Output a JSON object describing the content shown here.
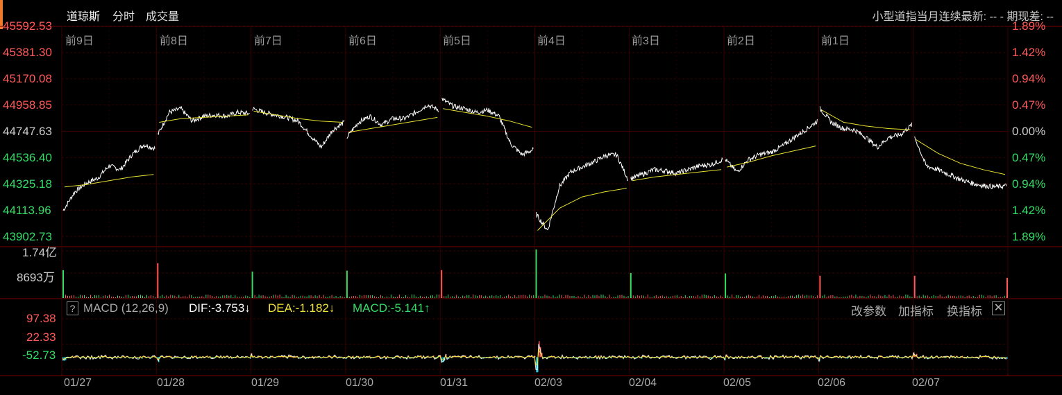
{
  "header": {
    "title": "道琼斯",
    "tab_minute": "分时",
    "tab_volume": "成交量",
    "info": "小型道指当月连续最新: --  -    期现差: --"
  },
  "price_axis": {
    "left_labels": [
      "45592.53",
      "45381.30",
      "45170.08",
      "44958.85",
      "44747.63",
      "44536.40",
      "44325.18",
      "44113.96",
      "43902.73"
    ],
    "right_labels": [
      "1.89%",
      "1.42%",
      "0.94%",
      "0.47%",
      "0.00%",
      "0.47%",
      "0.94%",
      "1.42%",
      "1.89%"
    ]
  },
  "day_labels": [
    "前9日",
    "前8日",
    "前7日",
    "前6日",
    "前5日",
    "前4日",
    "前3日",
    "前2日",
    "前1日"
  ],
  "volume_axis": {
    "top": "1.74亿",
    "mid": "8693万"
  },
  "macd": {
    "label": "MACD (12,26,9)",
    "dif": "DIF:-3.753↓",
    "dea": "DEA:-1.182↓",
    "macd": "MACD:-5.141↑",
    "btn_params": "改参数",
    "btn_add": "加指标",
    "btn_switch": "换指标",
    "help": "?",
    "close": "✕",
    "axis": [
      "97.38",
      "22.33",
      "-52.73"
    ]
  },
  "date_labels": [
    "01/27",
    "01/28",
    "01/29",
    "01/30",
    "01/31",
    "02/03",
    "02/04",
    "02/05",
    "02/06",
    "02/07"
  ],
  "colors": {
    "up": "#ff5a5a",
    "down": "#33dd66",
    "price_line": "#ffffff",
    "avg_line": "#e8e030",
    "cyan": "#22d0e8",
    "grid": "#3a0000"
  },
  "chart_data": [
    {
      "type": "line",
      "title": "道琼斯",
      "ylim": [
        43902.73,
        45592.53
      ],
      "base": 44747.63,
      "days": [
        "01/27",
        "01/28",
        "01/29",
        "01/30",
        "01/31",
        "02/03",
        "02/04",
        "02/05",
        "02/06",
        "02/07"
      ],
      "series": [
        {
          "name": "price",
          "day_points": [
            [
              44110,
              44260,
              44330,
              44370,
              44470,
              44440,
              44560,
              44640,
              44610
            ],
            [
              44720,
              44900,
              44930,
              44830,
              44870,
              44880,
              44870,
              44900,
              44890
            ],
            [
              44930,
              44900,
              44880,
              44860,
              44830,
              44720,
              44620,
              44760,
              44820
            ],
            [
              44700,
              44820,
              44870,
              44800,
              44850,
              44850,
              44900,
              44960,
              44920
            ],
            [
              45010,
              44950,
              44930,
              44900,
              44920,
              44870,
              44650,
              44560,
              44600
            ],
            [
              44080,
              43950,
              44300,
              44420,
              44460,
              44500,
              44550,
              44560,
              44360
            ],
            [
              44370,
              44400,
              44440,
              44430,
              44410,
              44440,
              44470,
              44480,
              44520
            ],
            [
              44520,
              44420,
              44520,
              44560,
              44580,
              44630,
              44700,
              44760,
              44830
            ],
            [
              44930,
              44820,
              44770,
              44760,
              44700,
              44620,
              44700,
              44720,
              44800
            ],
            [
              44700,
              44470,
              44440,
              44400,
              44360,
              44330,
              44310,
              44300,
              44310
            ]
          ]
        },
        {
          "name": "avg",
          "day_points": [
            [
              44300,
              44320,
              44350,
              44380,
              44400
            ],
            [
              44820,
              44850,
              44860,
              44870,
              44880
            ],
            [
              44910,
              44880,
              44850,
              44830,
              44820
            ],
            [
              44740,
              44770,
              44800,
              44830,
              44860
            ],
            [
              44930,
              44900,
              44870,
              44830,
              44780
            ],
            [
              43950,
              44130,
              44220,
              44260,
              44290
            ],
            [
              44350,
              44380,
              44400,
              44420,
              44440
            ],
            [
              44460,
              44500,
              44550,
              44590,
              44630
            ],
            [
              44920,
              44820,
              44790,
              44770,
              44760
            ],
            [
              44680,
              44570,
              44490,
              44440,
              44400
            ]
          ]
        }
      ]
    },
    {
      "type": "bar",
      "title": "成交量",
      "ylim": [
        0,
        174000000
      ],
      "opening_spikes": [
        {
          "day": "01/27",
          "value": 100000000,
          "dir": "down"
        },
        {
          "day": "01/28",
          "value": 125000000,
          "dir": "up"
        },
        {
          "day": "01/29",
          "value": 95000000,
          "dir": "down"
        },
        {
          "day": "01/30",
          "value": 98000000,
          "dir": "down"
        },
        {
          "day": "01/31",
          "value": 100000000,
          "dir": "up"
        },
        {
          "day": "02/03",
          "value": 174000000,
          "dir": "down"
        },
        {
          "day": "02/04",
          "value": 90000000,
          "dir": "down"
        },
        {
          "day": "02/05",
          "value": 88000000,
          "dir": "down"
        },
        {
          "day": "02/06",
          "value": 80000000,
          "dir": "up"
        },
        {
          "day": "02/07",
          "value": 80000000,
          "dir": "up"
        },
        {
          "day": "02/07 end",
          "value": 72000000,
          "dir": "up"
        }
      ]
    },
    {
      "type": "bar",
      "title": "MACD (12,26,9)",
      "ylim": [
        -52.73,
        97.38
      ],
      "dif": -3.753,
      "dea": -1.182,
      "macd": -5.141,
      "notable_events": [
        {
          "day": "01/31",
          "macd_min": -45,
          "macd_max": 30
        },
        {
          "day": "02/03",
          "macd_min": -50,
          "macd_max": 97
        }
      ]
    }
  ]
}
